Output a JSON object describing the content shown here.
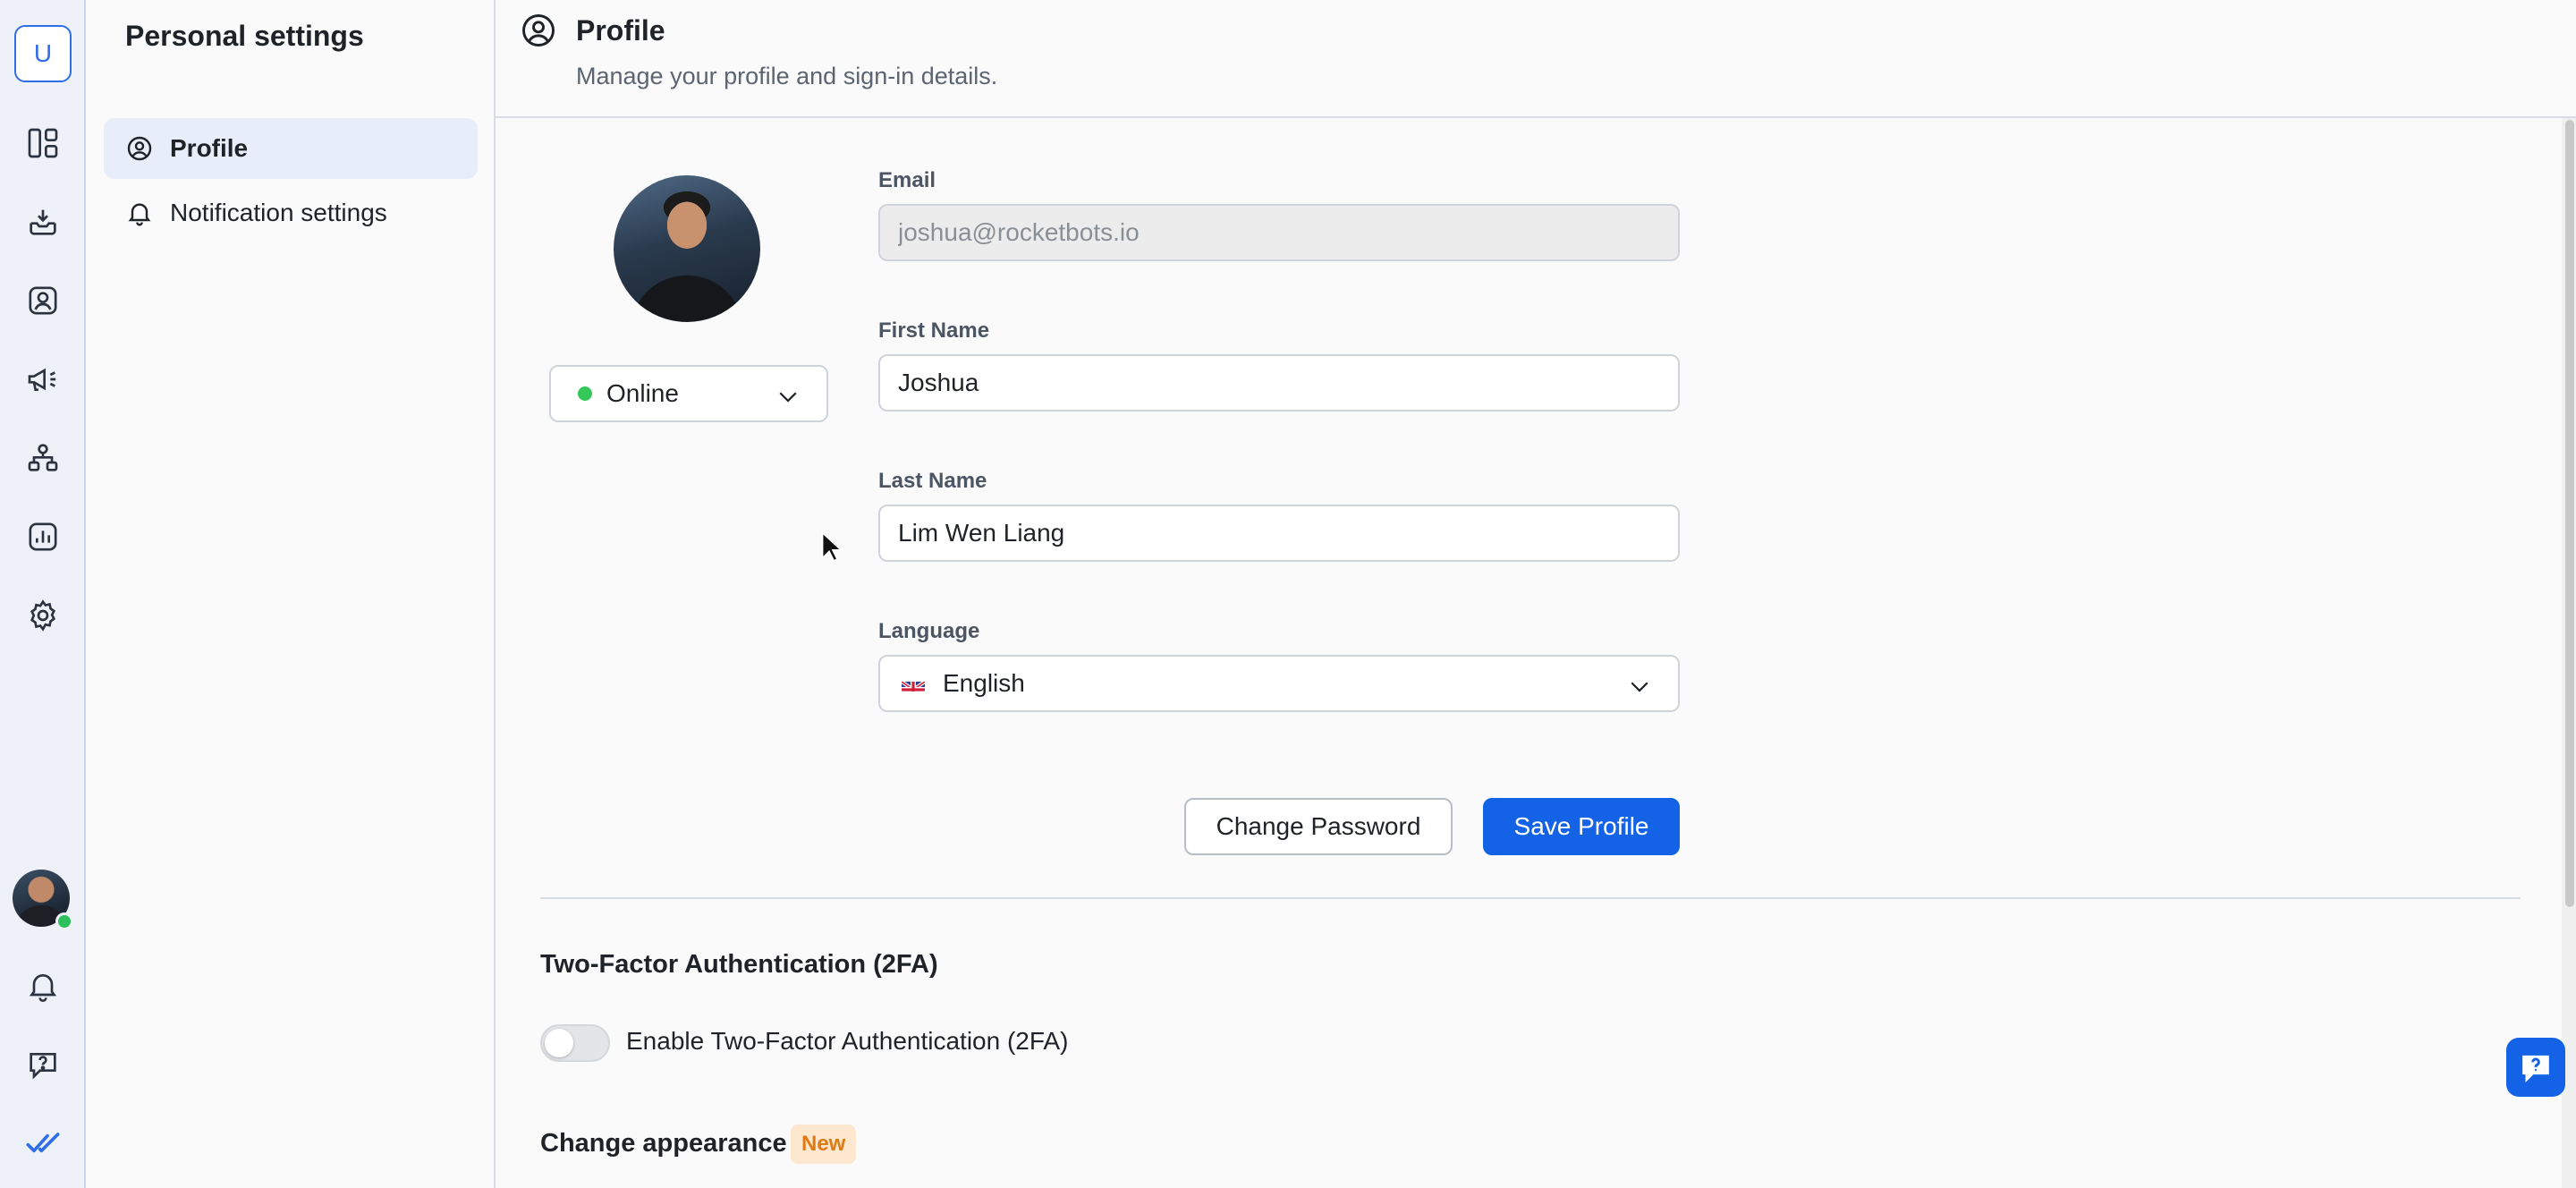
{
  "rail": {
    "workspace_initial": "U",
    "icons": [
      "layout-icon",
      "inbox-icon",
      "contacts-icon",
      "broadcast-icon",
      "workflows-icon",
      "reports-icon",
      "settings-icon"
    ],
    "bottom_icons": [
      "notifications-icon",
      "help-icon",
      "brand-logo-icon"
    ]
  },
  "sidebar": {
    "title": "Personal settings",
    "items": [
      {
        "label": "Profile",
        "icon": "user-circle-icon",
        "active": true
      },
      {
        "label": "Notification settings",
        "icon": "bell-icon",
        "active": false
      }
    ]
  },
  "header": {
    "title": "Profile",
    "subtitle": "Manage your profile and sign-in details."
  },
  "profile": {
    "status": "Online",
    "email_label": "Email",
    "email_value": "joshua@rocketbots.io",
    "first_name_label": "First Name",
    "first_name_value": "Joshua",
    "last_name_label": "Last Name",
    "last_name_value": "Lim Wen Liang",
    "language_label": "Language",
    "language_value": "English",
    "change_password_label": "Change Password",
    "save_label": "Save Profile"
  },
  "twofa": {
    "title": "Two-Factor Authentication (2FA)",
    "toggle_label": "Enable Two-Factor Authentication (2FA)",
    "enabled": false
  },
  "appearance": {
    "title": "Change appearance",
    "badge": "New"
  },
  "colors": {
    "primary": "#1463e6",
    "online": "#35c759",
    "badge_text": "#e07a12",
    "badge_bg": "#fde7cf"
  }
}
